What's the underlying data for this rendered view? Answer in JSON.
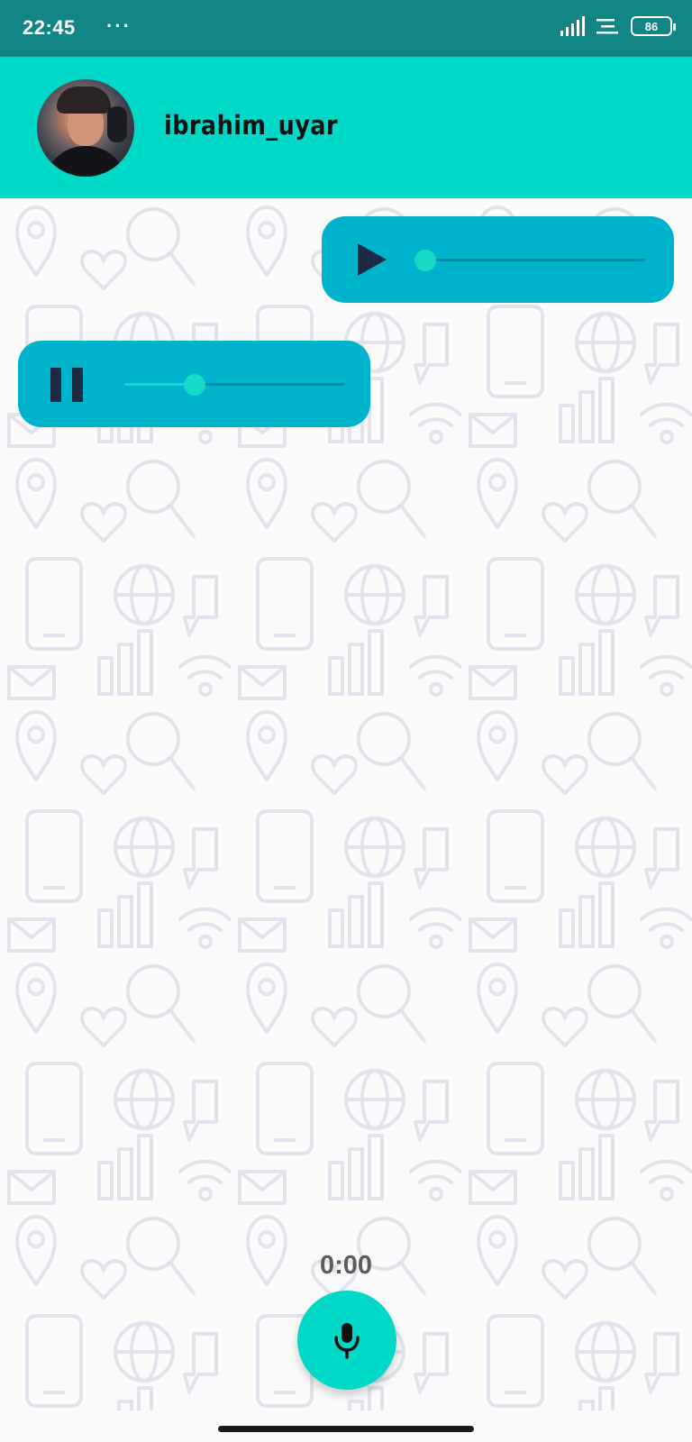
{
  "status_bar": {
    "time": "22:45",
    "dots": "···",
    "battery": "86",
    "icons": [
      "signal-icon",
      "notification-icon",
      "battery-icon"
    ]
  },
  "header": {
    "username": "ibrahim_uyar",
    "background_color": "#00d8c8"
  },
  "chat": {
    "messages": [
      {
        "direction": "sent",
        "state": "paused",
        "control_icon": "play-icon",
        "progress": 0.0
      },
      {
        "direction": "received",
        "state": "playing",
        "control_icon": "pause-icon",
        "progress": 0.32
      }
    ],
    "bubble_color": "#00b3cc",
    "accent_color": "#16d9c6"
  },
  "recorder": {
    "timer": "0:00",
    "button_icon": "microphone-icon"
  }
}
